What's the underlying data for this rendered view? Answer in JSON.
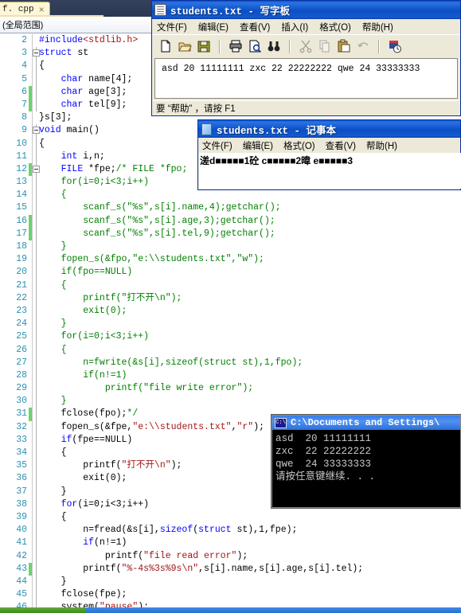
{
  "vs": {
    "tab": {
      "label": "f. cpp",
      "close": "×"
    },
    "scope": "(全局范围)",
    "lines": [
      {
        "n": "2",
        "indent": 1,
        "changed": false,
        "glyph": false,
        "text": "#include<stdlib.h>"
      },
      {
        "n": "3",
        "indent": 0,
        "changed": false,
        "glyph": true,
        "text": "struct st"
      },
      {
        "n": "4",
        "indent": 0,
        "changed": false,
        "glyph": false,
        "text": "{"
      },
      {
        "n": "5",
        "indent": 0,
        "changed": false,
        "glyph": false,
        "text": "    char name[4];"
      },
      {
        "n": "6",
        "indent": 0,
        "changed": true,
        "glyph": false,
        "text": "    char age[3];"
      },
      {
        "n": "7",
        "indent": 0,
        "changed": true,
        "glyph": false,
        "text": "    char tel[9];"
      },
      {
        "n": "8",
        "indent": 0,
        "changed": false,
        "glyph": false,
        "text": "}s[3];"
      },
      {
        "n": "9",
        "indent": 0,
        "changed": false,
        "glyph": true,
        "text": "void main()"
      },
      {
        "n": "10",
        "indent": 0,
        "changed": false,
        "glyph": false,
        "text": "{"
      },
      {
        "n": "11",
        "indent": 0,
        "changed": false,
        "glyph": false,
        "text": "    int i,n;"
      },
      {
        "n": "12",
        "indent": 0,
        "changed": true,
        "glyph": true,
        "text": "    FILE *fpe;/* FILE *fpo;"
      },
      {
        "n": "13",
        "indent": 0,
        "changed": false,
        "glyph": false,
        "text": "    for(i=0;i<3;i++)"
      },
      {
        "n": "14",
        "indent": 0,
        "changed": false,
        "glyph": false,
        "text": "    {"
      },
      {
        "n": "15",
        "indent": 0,
        "changed": false,
        "glyph": false,
        "text": "        scanf_s(\"%s\",s[i].name,4);getchar();"
      },
      {
        "n": "16",
        "indent": 0,
        "changed": true,
        "glyph": false,
        "text": "        scanf_s(\"%s\",s[i].age,3);getchar();"
      },
      {
        "n": "17",
        "indent": 0,
        "changed": true,
        "glyph": false,
        "text": "        scanf_s(\"%s\",s[i].tel,9);getchar();"
      },
      {
        "n": "18",
        "indent": 0,
        "changed": false,
        "glyph": false,
        "text": "    }"
      },
      {
        "n": "19",
        "indent": 0,
        "changed": false,
        "glyph": false,
        "text": "    fopen_s(&fpo,\"e:\\\\students.txt\",\"w\");"
      },
      {
        "n": "20",
        "indent": 0,
        "changed": false,
        "glyph": false,
        "text": "    if(fpo==NULL)"
      },
      {
        "n": "21",
        "indent": 0,
        "changed": false,
        "glyph": false,
        "text": "    {"
      },
      {
        "n": "22",
        "indent": 0,
        "changed": false,
        "glyph": false,
        "text": "        printf(\"打不开\\n\");"
      },
      {
        "n": "23",
        "indent": 0,
        "changed": false,
        "glyph": false,
        "text": "        exit(0);"
      },
      {
        "n": "24",
        "indent": 0,
        "changed": false,
        "glyph": false,
        "text": "    }"
      },
      {
        "n": "25",
        "indent": 0,
        "changed": false,
        "glyph": false,
        "text": "    for(i=0;i<3;i++)"
      },
      {
        "n": "26",
        "indent": 0,
        "changed": false,
        "glyph": false,
        "text": "    {"
      },
      {
        "n": "27",
        "indent": 0,
        "changed": false,
        "glyph": false,
        "text": "        n=fwrite(&s[i],sizeof(struct st),1,fpo);"
      },
      {
        "n": "28",
        "indent": 0,
        "changed": false,
        "glyph": false,
        "text": "        if(n!=1)"
      },
      {
        "n": "29",
        "indent": 0,
        "changed": false,
        "glyph": false,
        "text": "            printf(\"file write error\");"
      },
      {
        "n": "30",
        "indent": 0,
        "changed": false,
        "glyph": false,
        "text": "    }"
      },
      {
        "n": "31",
        "indent": 0,
        "changed": true,
        "glyph": false,
        "text": "    fclose(fpo);*/"
      },
      {
        "n": "32",
        "indent": 0,
        "changed": false,
        "glyph": false,
        "text": "    fopen_s(&fpe,\"e:\\\\students.txt\",\"r\");"
      },
      {
        "n": "33",
        "indent": 0,
        "changed": false,
        "glyph": false,
        "text": "    if(fpe==NULL)"
      },
      {
        "n": "34",
        "indent": 0,
        "changed": false,
        "glyph": false,
        "text": "    {"
      },
      {
        "n": "35",
        "indent": 0,
        "changed": false,
        "glyph": false,
        "text": "        printf(\"打不开\\n\");"
      },
      {
        "n": "36",
        "indent": 0,
        "changed": false,
        "glyph": false,
        "text": "        exit(0);"
      },
      {
        "n": "37",
        "indent": 0,
        "changed": false,
        "glyph": false,
        "text": "    }"
      },
      {
        "n": "38",
        "indent": 0,
        "changed": false,
        "glyph": false,
        "text": "    for(i=0;i<3;i++)"
      },
      {
        "n": "39",
        "indent": 0,
        "changed": false,
        "glyph": false,
        "text": "    {"
      },
      {
        "n": "40",
        "indent": 0,
        "changed": false,
        "glyph": false,
        "text": "        n=fread(&s[i],sizeof(struct st),1,fpe);"
      },
      {
        "n": "41",
        "indent": 0,
        "changed": false,
        "glyph": false,
        "text": "        if(n!=1)"
      },
      {
        "n": "42",
        "indent": 0,
        "changed": false,
        "glyph": false,
        "text": "            printf(\"file read error\");"
      },
      {
        "n": "43",
        "indent": 0,
        "changed": true,
        "glyph": false,
        "text": "        printf(\"%-4s%3s%9s\\n\",s[i].name,s[i].age,s[i].tel);"
      },
      {
        "n": "44",
        "indent": 0,
        "changed": false,
        "glyph": false,
        "text": "    }"
      },
      {
        "n": "45",
        "indent": 0,
        "changed": false,
        "glyph": false,
        "text": "    fclose(fpe);"
      },
      {
        "n": "46",
        "indent": 0,
        "changed": false,
        "glyph": false,
        "text": "    system(\"pause\");"
      }
    ]
  },
  "wordpad": {
    "title": "students.txt - 写字板",
    "menus": [
      "文件(F)",
      "编辑(E)",
      "查看(V)",
      "插入(I)",
      "格式(O)",
      "帮助(H)"
    ],
    "toolbar_icons": [
      "new-document-icon",
      "open-folder-icon",
      "save-disk-icon",
      "print-icon",
      "print-preview-icon",
      "find-binoculars-icon",
      "cut-scissors-icon",
      "copy-icon",
      "paste-icon",
      "undo-icon",
      "date-time-icon"
    ],
    "document_text": "asd 20 11111111 zxc 22 22222222 qwe 24 33333333",
    "status": "要 “帮助” ，请按 F1"
  },
  "notepad": {
    "title": "students.txt - 记事本",
    "menus": [
      "文件(F)",
      "编辑(E)",
      "格式(O)",
      "查看(V)",
      "帮助(H)"
    ],
    "document_text": "溠d■■■■■1砼 c■■■■■2暐 e■■■■■3"
  },
  "console": {
    "title": "C:\\Documents and Settings\\",
    "icon": "C:\\",
    "lines": [
      "asd  20 11111111",
      "zxc  22 22222222",
      "qwe  24 33333333",
      "请按任意键继续. . ."
    ]
  },
  "colors": {
    "vs_tab_bg": "#fdf6d8",
    "vs_chrome": "#2d3b55",
    "line_number": "#2b91af",
    "keyword": "#0000ff",
    "string": "#a31515",
    "comment": "#008000",
    "change_marker": "#6fd16f",
    "window_title": "#0b4fc4",
    "window_face": "#ece9d8",
    "console_bg": "#000000",
    "console_fg": "#c8c8c8"
  }
}
